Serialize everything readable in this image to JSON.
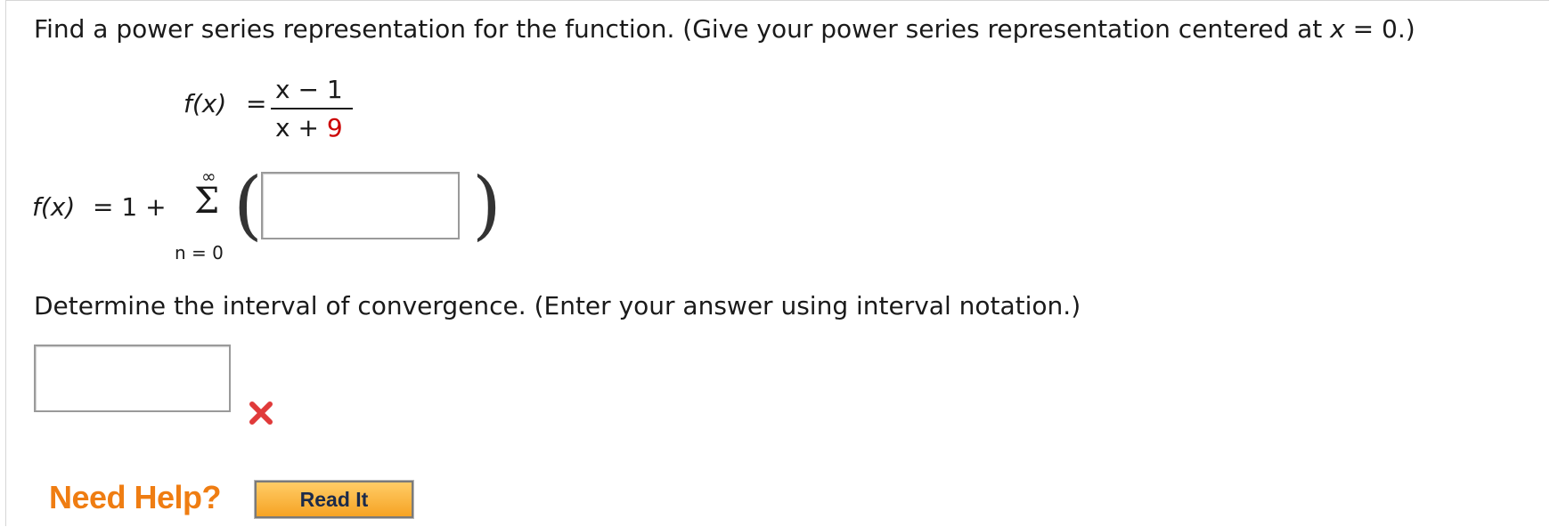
{
  "question": {
    "prompt_before_x": "Find a power series representation for the function. (Give your power series representation centered at",
    "prompt_var": "x",
    "prompt_after_x": "= 0.)"
  },
  "function": {
    "lhs": "f(x)",
    "equals": "=",
    "numerator": "x − 1",
    "denominator_var": "x +",
    "denominator_const": "9"
  },
  "series": {
    "lhs": "f(x)",
    "equals_term": "= 1 +",
    "upper_limit": "∞",
    "sigma": "Σ",
    "lower_limit": "n = 0",
    "left_paren": "(",
    "right_paren": ")",
    "answer_value": ""
  },
  "interval": {
    "prompt": "Determine the interval of convergence. (Enter your answer using interval notation.)",
    "answer_value": "",
    "status_icon": "incorrect-x-icon",
    "status_color": "#e03a3a"
  },
  "help": {
    "label": "Need Help?",
    "read_it_button": "Read It"
  },
  "colors": {
    "accent_orange": "#ef7d12",
    "constant_red": "#cc0000"
  }
}
